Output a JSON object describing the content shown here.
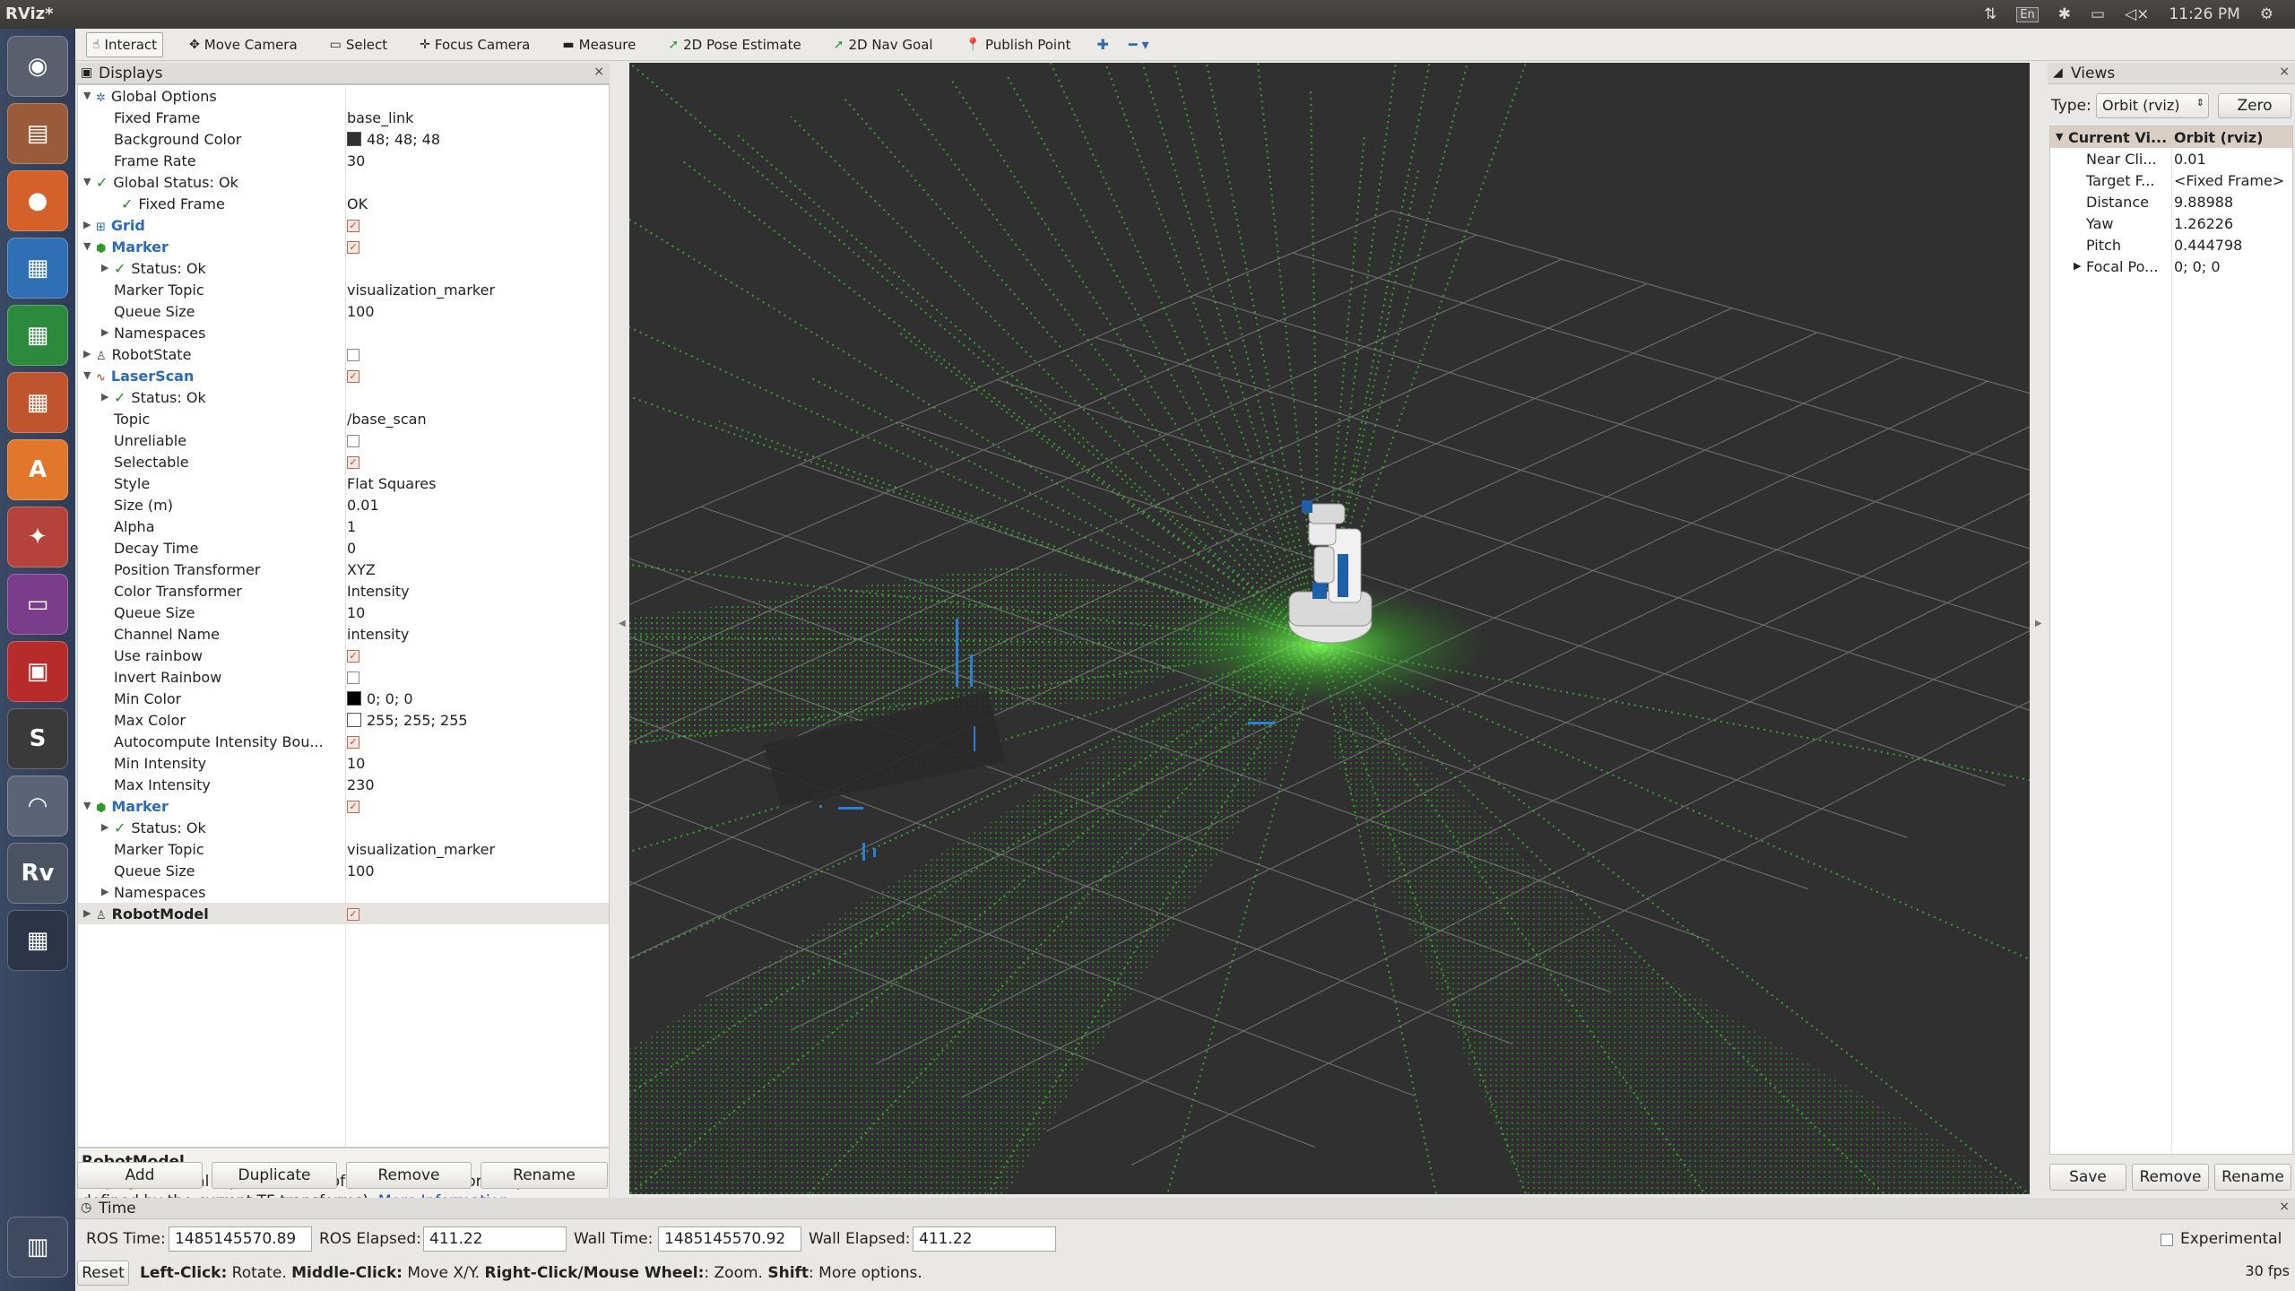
{
  "window": {
    "title": "RViz*"
  },
  "tray": {
    "keyboard": "En",
    "clock": "11:26 PM"
  },
  "toolbar": {
    "tools": [
      {
        "name": "interact-tool",
        "label": "Interact",
        "icon": "hand-icon",
        "active": true
      },
      {
        "name": "move-camera-tool",
        "label": "Move Camera",
        "icon": "move-icon"
      },
      {
        "name": "select-tool",
        "label": "Select",
        "icon": "select-rect-icon"
      },
      {
        "name": "focus-camera-tool",
        "label": "Focus Camera",
        "icon": "crosshair-icon"
      },
      {
        "name": "measure-tool",
        "label": "Measure",
        "icon": "ruler-icon"
      },
      {
        "name": "pose-estimate-tool",
        "label": "2D Pose Estimate",
        "icon": "green-arrow-icon"
      },
      {
        "name": "nav-goal-tool",
        "label": "2D Nav Goal",
        "icon": "green-arrow-icon"
      },
      {
        "name": "publish-point-tool",
        "label": "Publish Point",
        "icon": "pin-icon"
      }
    ]
  },
  "displays": {
    "title": "Displays",
    "rows": [
      {
        "indent": 0,
        "arrow": "▼",
        "icon": "gear-icon",
        "label": "Global Options",
        "value": ""
      },
      {
        "indent": 1,
        "label": "Fixed Frame",
        "value": "base_link"
      },
      {
        "indent": 1,
        "label": "Background Color",
        "value": "48; 48; 48",
        "swatch": "#303030"
      },
      {
        "indent": 1,
        "label": "Frame Rate",
        "value": "30"
      },
      {
        "indent": 0,
        "arrow": "▼",
        "check": true,
        "label": "Global Status: Ok",
        "value": ""
      },
      {
        "indent": 1,
        "check": true,
        "label": "Fixed Frame",
        "value": "OK"
      },
      {
        "indent": 0,
        "arrow": "▶",
        "icon": "grid-icon",
        "label": "Grid",
        "cat": true,
        "box": "on"
      },
      {
        "indent": 0,
        "arrow": "▼",
        "icon": "marker-icon",
        "label": "Marker",
        "cat": true,
        "box": "on"
      },
      {
        "indent": 1,
        "arrow": "▶",
        "check": true,
        "label": "Status: Ok",
        "value": ""
      },
      {
        "indent": 1,
        "label": "Marker Topic",
        "value": "visualization_marker"
      },
      {
        "indent": 1,
        "label": "Queue Size",
        "value": "100"
      },
      {
        "indent": 1,
        "arrow": "▶",
        "label": "Namespaces",
        "value": ""
      },
      {
        "indent": 0,
        "arrow": "▶",
        "icon": "robot-icon",
        "label": "RobotState",
        "box": "off"
      },
      {
        "indent": 0,
        "arrow": "▼",
        "icon": "laser-icon",
        "label": "LaserScan",
        "cat": true,
        "box": "on"
      },
      {
        "indent": 1,
        "arrow": "▶",
        "check": true,
        "label": "Status: Ok",
        "value": ""
      },
      {
        "indent": 1,
        "label": "Topic",
        "value": "/base_scan"
      },
      {
        "indent": 1,
        "label": "Unreliable",
        "box": "off"
      },
      {
        "indent": 1,
        "label": "Selectable",
        "box": "on"
      },
      {
        "indent": 1,
        "label": "Style",
        "value": "Flat Squares"
      },
      {
        "indent": 1,
        "label": "Size (m)",
        "value": "0.01"
      },
      {
        "indent": 1,
        "label": "Alpha",
        "value": "1"
      },
      {
        "indent": 1,
        "label": "Decay Time",
        "value": "0"
      },
      {
        "indent": 1,
        "label": "Position Transformer",
        "value": "XYZ"
      },
      {
        "indent": 1,
        "label": "Color Transformer",
        "value": "Intensity"
      },
      {
        "indent": 1,
        "label": "Queue Size",
        "value": "10"
      },
      {
        "indent": 1,
        "label": "Channel Name",
        "value": "intensity"
      },
      {
        "indent": 1,
        "label": "Use rainbow",
        "box": "on"
      },
      {
        "indent": 1,
        "label": "Invert Rainbow",
        "box": "off"
      },
      {
        "indent": 1,
        "label": "Min Color",
        "value": "0; 0; 0",
        "swatch": "#000000"
      },
      {
        "indent": 1,
        "label": "Max Color",
        "value": "255; 255; 255",
        "swatch": "#ffffff"
      },
      {
        "indent": 1,
        "label": "Autocompute Intensity Bou...",
        "box": "on"
      },
      {
        "indent": 1,
        "label": "Min Intensity",
        "value": "10"
      },
      {
        "indent": 1,
        "label": "Max Intensity",
        "value": "230"
      },
      {
        "indent": 0,
        "arrow": "▼",
        "icon": "marker-icon",
        "label": "Marker",
        "cat": true,
        "box": "on"
      },
      {
        "indent": 1,
        "arrow": "▶",
        "check": true,
        "label": "Status: Ok",
        "value": ""
      },
      {
        "indent": 1,
        "label": "Marker Topic",
        "value": "visualization_marker"
      },
      {
        "indent": 1,
        "label": "Queue Size",
        "value": "100"
      },
      {
        "indent": 1,
        "arrow": "▶",
        "label": "Namespaces",
        "value": ""
      },
      {
        "indent": 0,
        "arrow": "▶",
        "icon": "robot-icon",
        "label": "RobotModel",
        "bold": true,
        "box": "on",
        "selected": true
      }
    ],
    "description": {
      "title": "RobotModel",
      "text": "Displays a visual representation of a robot in the correct pose (as defined by the current TF transforms).",
      "link": "More Information"
    },
    "buttons": {
      "add": "Add",
      "duplicate": "Duplicate",
      "remove": "Remove",
      "rename": "Rename"
    }
  },
  "views": {
    "title": "Views",
    "type_label": "Type:",
    "type_value": "Orbit (rviz)",
    "zero": "Zero",
    "header": {
      "name": "Current Vi...",
      "value": "Orbit (rviz)"
    },
    "rows": [
      {
        "label": "Near Cli...",
        "value": "0.01"
      },
      {
        "label": "Target F...",
        "value": "<Fixed Frame>"
      },
      {
        "label": "Distance",
        "value": "9.88988"
      },
      {
        "label": "Yaw",
        "value": "1.26226"
      },
      {
        "label": "Pitch",
        "value": "0.444798"
      },
      {
        "label": "Focal Po...",
        "value": "0; 0; 0",
        "arrow": "▶"
      }
    ],
    "buttons": {
      "save": "Save",
      "remove": "Remove",
      "rename": "Rename"
    }
  },
  "time": {
    "title": "Time",
    "ros_time_label": "ROS Time:",
    "ros_time": "1485145570.89",
    "ros_elapsed_label": "ROS Elapsed:",
    "ros_elapsed": "411.22",
    "wall_time_label": "Wall Time:",
    "wall_time": "1485145570.92",
    "wall_elapsed_label": "Wall Elapsed:",
    "wall_elapsed": "411.22",
    "experimental": "Experimental",
    "reset": "Reset",
    "hint": [
      {
        "b": "Left-Click:",
        "t": " Rotate. "
      },
      {
        "b": "Middle-Click:",
        "t": " Move X/Y. "
      },
      {
        "b": "Right-Click/Mouse Wheel:",
        "t": ": Zoom. "
      },
      {
        "b": "Shift",
        "t": ": More options."
      }
    ],
    "fps": "30 fps"
  },
  "launcher": {
    "items": [
      {
        "name": "dash-icon",
        "glyph": "◉",
        "color": "#5a5f6e"
      },
      {
        "name": "files-icon",
        "glyph": "▤",
        "color": "#9a5b3a"
      },
      {
        "name": "firefox-icon",
        "glyph": "●",
        "color": "#d4612a"
      },
      {
        "name": "writer-icon",
        "glyph": "▦",
        "color": "#2f6fb6"
      },
      {
        "name": "calc-icon",
        "glyph": "▦",
        "color": "#2c8a3c"
      },
      {
        "name": "impress-icon",
        "glyph": "▦",
        "color": "#c0542c"
      },
      {
        "name": "software-center-icon",
        "glyph": "A",
        "color": "#e0772a"
      },
      {
        "name": "settings-icon",
        "glyph": "✦",
        "color": "#b5433c"
      },
      {
        "name": "app-icon",
        "glyph": "▭",
        "color": "#7b3c8c"
      },
      {
        "name": "remote-icon",
        "glyph": "▣",
        "color": "#b82b2b"
      },
      {
        "name": "sublime-icon",
        "glyph": "S",
        "color": "#3a3a3a"
      },
      {
        "name": "wifi-icon",
        "glyph": "◠",
        "color": "#5b6477"
      },
      {
        "name": "rviz-icon",
        "glyph": "Rv",
        "color": "#4b5262"
      },
      {
        "name": "workspace-icon",
        "glyph": "▦",
        "color": "#2c3548"
      }
    ],
    "trash": {
      "name": "trash-icon",
      "glyph": "🗑",
      "color": "#3f4a60"
    }
  }
}
